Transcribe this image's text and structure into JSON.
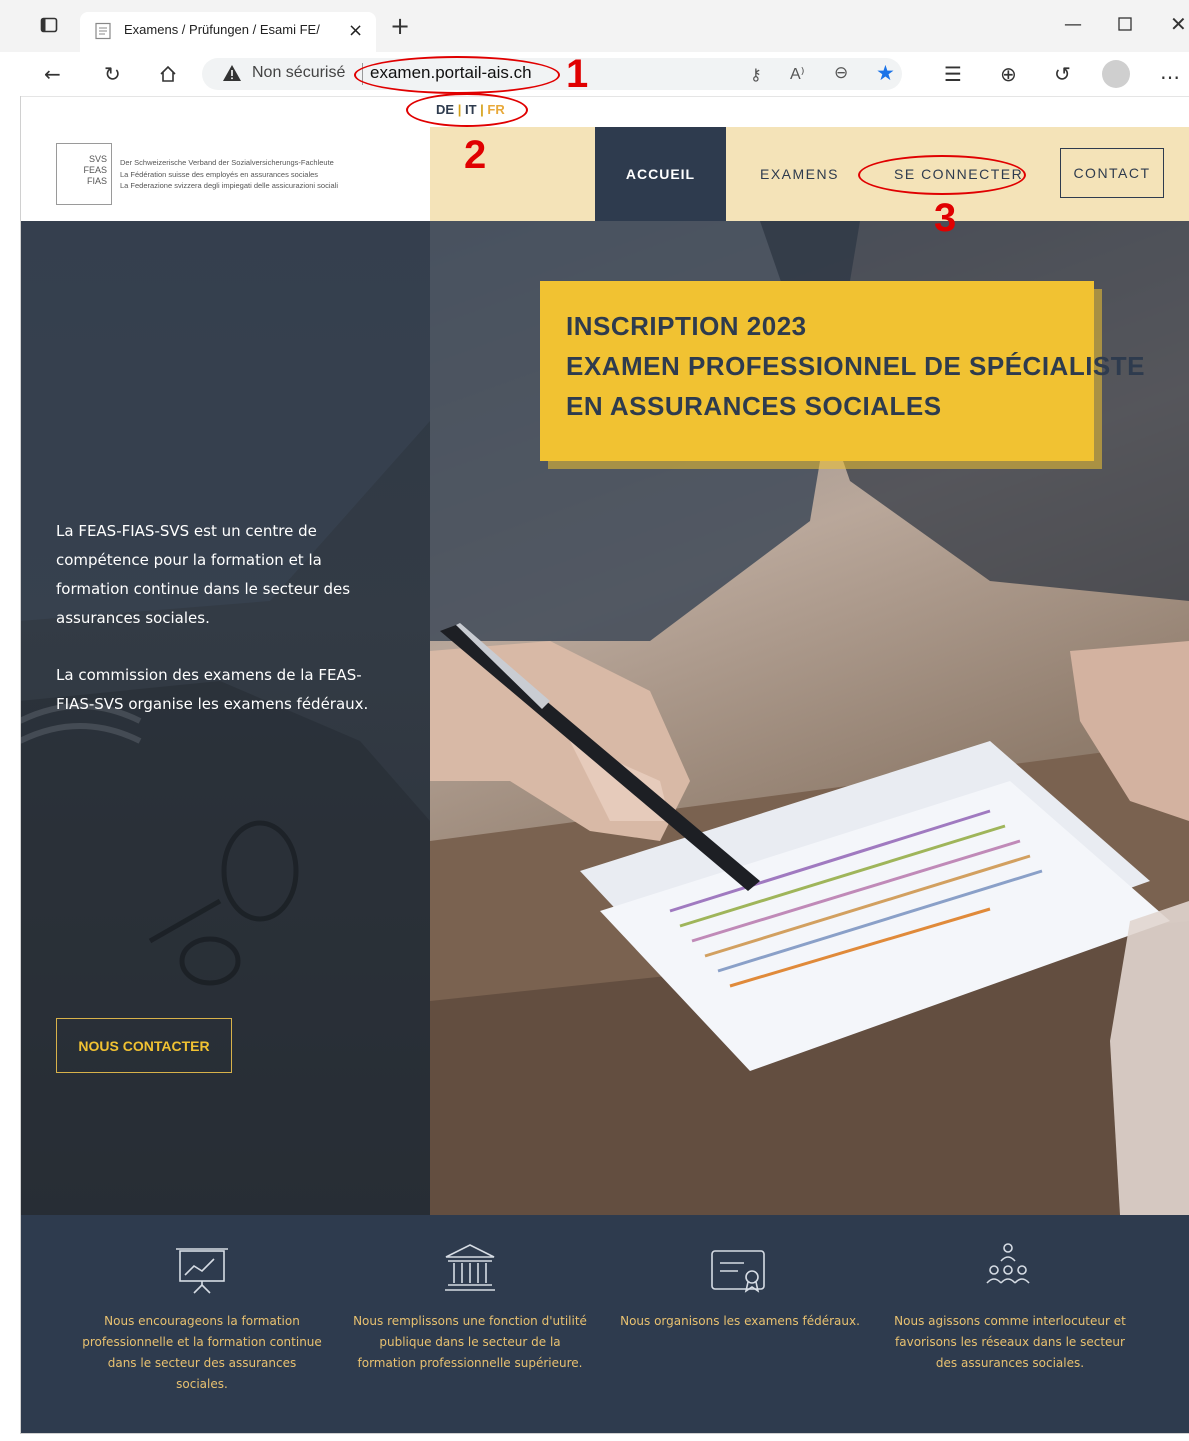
{
  "browser": {
    "tab_title": "Examens / Prüfungen / Esami FE/",
    "security_label": "Non sécurisé",
    "url": "examen.portail-ais.ch",
    "new_tab_label": "+",
    "close_tab_label": "×"
  },
  "language": {
    "de": "DE",
    "sep1": "|",
    "it": "IT",
    "sep2": "|",
    "fr": "FR"
  },
  "logo": {
    "mark_lines": [
      "SVS",
      "FEAS",
      "FIAS"
    ],
    "lines": [
      "Der Schweizerische Verband der Sozialversicherungs-Fachleute",
      "La Fédération suisse des employés en assurances sociales",
      "La Federazione svizzera degli impiegati delle assicurazioni sociali"
    ]
  },
  "nav": {
    "accueil": "ACCUEIL",
    "examens": "EXAMENS",
    "se_connecter": "SE CONNECTER",
    "contact": "CONTACT"
  },
  "hero": {
    "title_lines": [
      "INSCRIPTION 2023",
      "EXAMEN PROFESSIONNEL DE SPÉCIALISTE",
      "EN ASSURANCES SOCIALES"
    ],
    "paragraph1": "La FEAS-FIAS-SVS est un centre de compétence pour la formation et la formation continue dans le secteur des assurances sociales.",
    "paragraph2": "La commission des examens de la FEAS-FIAS-SVS organise les examens fédéraux.",
    "contact_button": "NOUS CONTACTER"
  },
  "features": [
    {
      "icon": "presentation-chart-icon",
      "text": "Nous encourageons la formation professionnelle et la formation continue dans le secteur des assurances sociales."
    },
    {
      "icon": "public-building-icon",
      "text": "Nous remplissons une fonction d'utilité publique dans le secteur de la formation professionnelle supérieure."
    },
    {
      "icon": "certificate-icon",
      "text": "Nous organisons les examens fédéraux."
    },
    {
      "icon": "network-people-icon",
      "text": "Nous agissons comme interlocuteur et favorisons les réseaux dans le secteur des assurances sociales."
    }
  ],
  "annotations": {
    "one": "1",
    "two": "2",
    "three": "3"
  },
  "colors": {
    "navy": "#2e3b4e",
    "gold": "#f1c232",
    "nav_bg": "#f4e3b8",
    "annotation_red": "#e00000"
  }
}
